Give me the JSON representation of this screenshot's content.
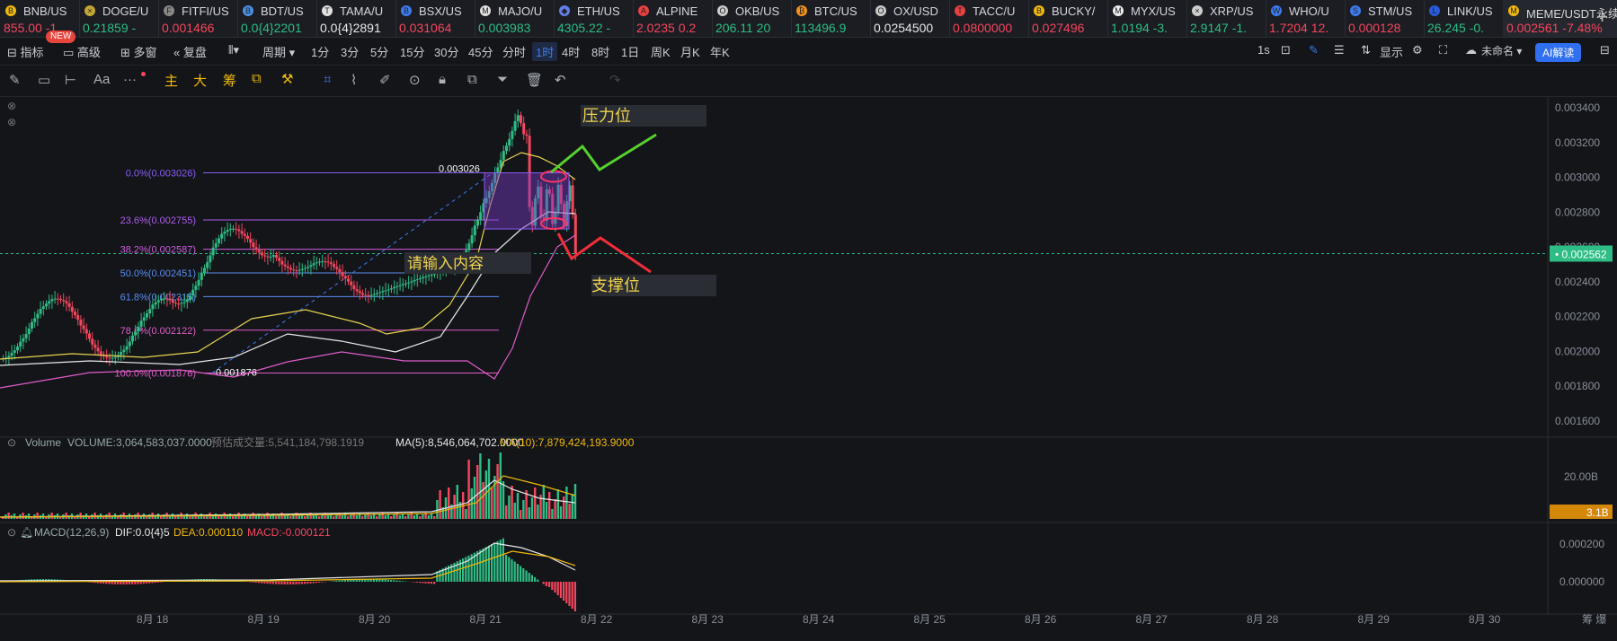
{
  "tabs": [
    {
      "symbol": "BNB/US",
      "price": "855.00 -1",
      "dir": "dn",
      "icon": "B",
      "color": "#f0b90b"
    },
    {
      "symbol": "DOGE/U",
      "price": "0.21859 -",
      "dir": "up",
      "icon": "×",
      "color": "#c2a633"
    },
    {
      "symbol": "FITFI/US",
      "price": "0.001466",
      "dir": "dn",
      "icon": "F",
      "color": "#888"
    },
    {
      "symbol": "BDT/US",
      "price": "0.0{4}2201",
      "dir": "up",
      "icon": "B",
      "color": "#4a90e2"
    },
    {
      "symbol": "TAMA/U",
      "price": "0.0{4}2891",
      "dir": "wh",
      "icon": "T",
      "color": "#e0e0e0"
    },
    {
      "symbol": "BSX/US",
      "price": "0.031064",
      "dir": "dn",
      "icon": "B",
      "color": "#3d7cf0"
    },
    {
      "symbol": "MAJO/U",
      "price": "0.003983",
      "dir": "up",
      "icon": "M",
      "color": "#e0e0e0"
    },
    {
      "symbol": "ETH/US",
      "price": "4305.22 -",
      "dir": "up",
      "icon": "◆",
      "color": "#627eea"
    },
    {
      "symbol": "ALPINE",
      "price": "2.0235 0.2",
      "dir": "dn",
      "icon": "A",
      "color": "#e84142"
    },
    {
      "symbol": "OKB/US",
      "price": "206.11 20",
      "dir": "up",
      "icon": "O",
      "color": "#ccc"
    },
    {
      "symbol": "BTC/US",
      "price": "113496.9",
      "dir": "up",
      "icon": "₿",
      "color": "#f7931a"
    },
    {
      "symbol": "OX/USD",
      "price": "0.0254500",
      "dir": "wh",
      "icon": "O",
      "color": "#ccc"
    },
    {
      "symbol": "TACC/U",
      "price": "0.0800000",
      "dir": "dn",
      "icon": "T",
      "color": "#e84142"
    },
    {
      "symbol": "BUCKY/",
      "price": "0.027496",
      "dir": "dn",
      "icon": "B",
      "color": "#f0b90b"
    },
    {
      "symbol": "MYX/US",
      "price": "1.0194 -3.",
      "dir": "up",
      "icon": "M",
      "color": "#eee"
    },
    {
      "symbol": "XRP/US",
      "price": "2.9147 -1.",
      "dir": "up",
      "icon": "×",
      "color": "#ccc"
    },
    {
      "symbol": "WHO/U",
      "price": "1.7204 12.",
      "dir": "dn",
      "icon": "W",
      "color": "#3d7cf0"
    },
    {
      "symbol": "STM/US",
      "price": "0.000128",
      "dir": "dn",
      "icon": "S",
      "color": "#3d7cf0"
    },
    {
      "symbol": "LINK/US",
      "price": "26.245 -0.",
      "dir": "up",
      "icon": "L",
      "color": "#2a5ada"
    },
    {
      "symbol": "MEME/USDT永续",
      "price": "0.002561 -7.48%",
      "dir": "dn",
      "icon": "M",
      "color": "#f0b90b",
      "active": true
    }
  ],
  "new_badge": "NEW",
  "toolbar1": {
    "indicator": "指标",
    "advanced": "高级",
    "multi": "多窗",
    "replay": "复盘",
    "period": "周期",
    "timeframes": [
      "1分",
      "3分",
      "5分",
      "15分",
      "30分",
      "45分",
      "分时",
      "1时",
      "4时",
      "8时",
      "1日",
      "周K",
      "月K",
      "年K"
    ],
    "selected": "1时",
    "right_refresh": "1s",
    "display": "显示",
    "unnamed": "未命名",
    "ai": "AI解读"
  },
  "toolbar2": {
    "main": "主",
    "big": "大",
    "chip": "筹",
    "font_label": "Aa"
  },
  "fib": {
    "levels": [
      {
        "label": "0.0%(0.003026)",
        "value": 0.003026,
        "color": "#8a5cf5"
      },
      {
        "label": "23.6%(0.002755)",
        "value": 0.002755,
        "color": "#b05cf0"
      },
      {
        "label": "38.2%(0.002587)",
        "value": 0.002587,
        "color": "#d05ce0"
      },
      {
        "label": "50.0%(0.002451)",
        "value": 0.002451,
        "color": "#5c8cf0"
      },
      {
        "label": "61.8%(0.002315)",
        "value": 0.002315,
        "color": "#5c8cf0"
      },
      {
        "label": "78.6%(0.002122)",
        "value": 0.002122,
        "color": "#e05cc8"
      },
      {
        "label": "100.0%(0.001876)",
        "value": 0.001876,
        "color": "#e05cc8"
      }
    ],
    "high_label": "0.003026",
    "low_label": "0.001876"
  },
  "annotations": {
    "resistance": "压力位",
    "support": "支撑位",
    "input_hint": "请输入内容"
  },
  "price_axis": {
    "ticks": [
      "0.003400",
      "0.003200",
      "0.003000",
      "0.002800",
      "0.002600",
      "0.002400",
      "0.002200",
      "0.002000",
      "0.001800",
      "0.001600"
    ],
    "current": "0.002562"
  },
  "volume": {
    "title": "Volume",
    "volume": "VOLUME:3,064,583,037.0000",
    "forecast": "预估成交量:5,541,184,798.1919",
    "ma5": "MA(5):8,546,064,702.0000",
    "ma10": "MA(10):7,879,424,193.9000",
    "axis": "20.00B",
    "current": "3.1B"
  },
  "macd": {
    "title": "MACD(12,26,9)",
    "dif": "DIF:0.0{4}5",
    "dea": "DEA:0.000110",
    "macd": "MACD:-0.000121",
    "axis": [
      "0.000200",
      "0.000000"
    ]
  },
  "dates": [
    "8月 18",
    "8月 19",
    "8月 20",
    "8月 21",
    "8月 22",
    "8月 23",
    "8月 24",
    "8月 25",
    "8月 26",
    "8月 27",
    "8月 28",
    "8月 29",
    "8月 30"
  ],
  "bottom_right": "筹 爆",
  "colors": {
    "up": "#2ebd85",
    "down": "#f6465d",
    "accent": "#3d7cf0",
    "ai": "#2f6ff0",
    "current_line": "#2ebd85"
  }
}
